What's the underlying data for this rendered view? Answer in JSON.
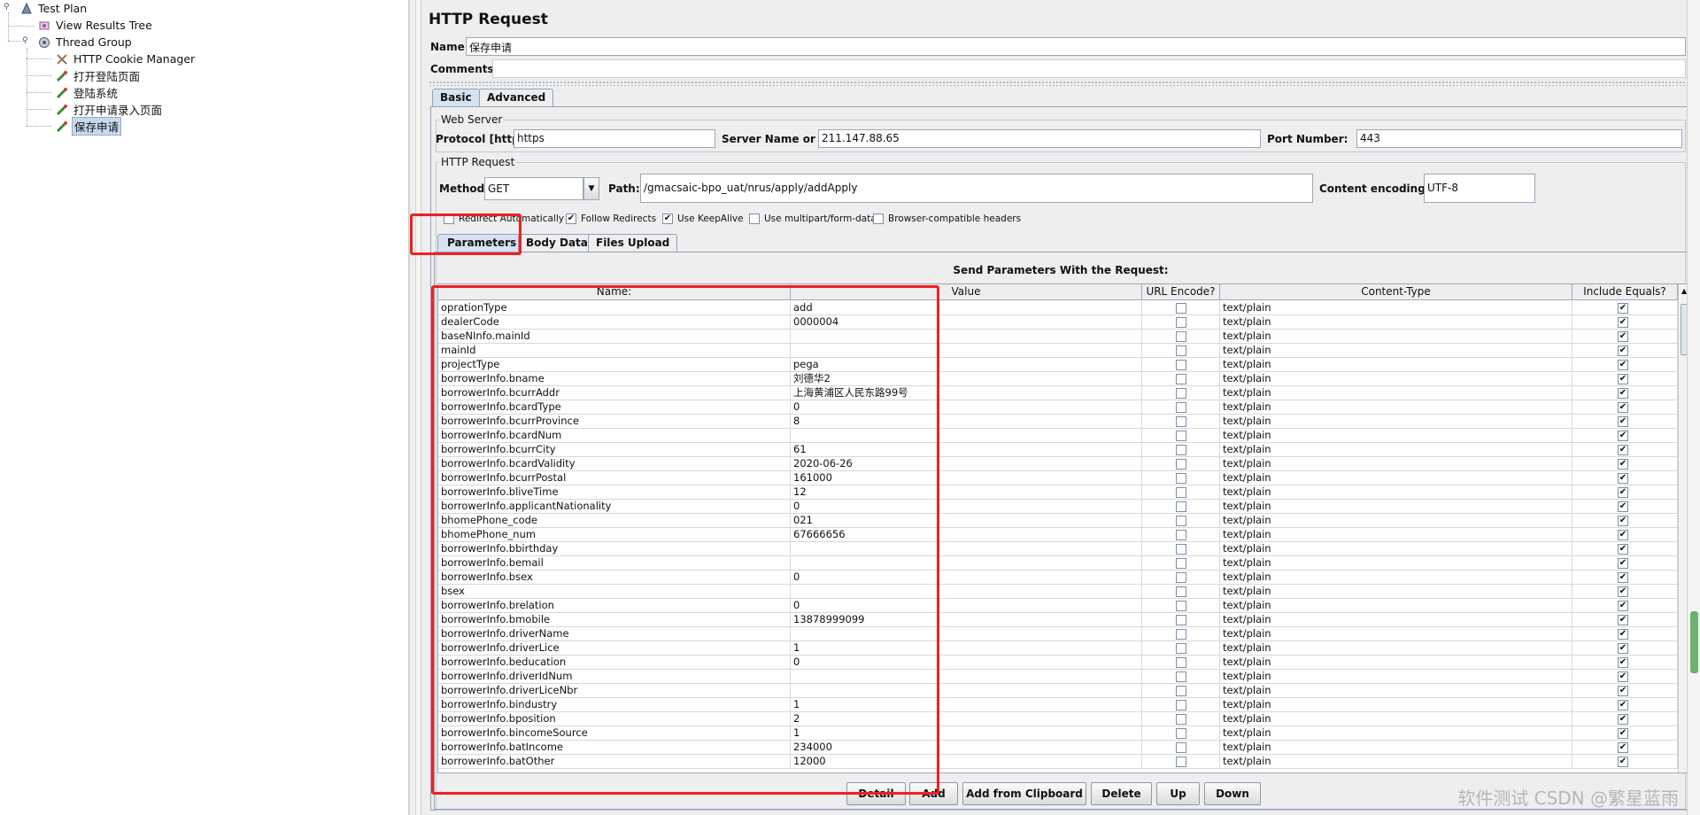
{
  "tree": {
    "items": [
      {
        "label": "Test Plan",
        "icon": "test-plan-icon"
      },
      {
        "label": "View Results Tree",
        "icon": "results-tree-icon"
      },
      {
        "label": "Thread Group",
        "icon": "thread-group-icon"
      },
      {
        "label": "HTTP Cookie Manager",
        "icon": "cookie-manager-icon"
      },
      {
        "label": "打开登陆页面",
        "icon": "sampler-icon"
      },
      {
        "label": "登陆系统",
        "icon": "sampler-icon"
      },
      {
        "label": "打开申请录入页面",
        "icon": "sampler-icon"
      },
      {
        "label": "保存申请",
        "icon": "sampler-icon",
        "selected": true
      }
    ]
  },
  "panel": {
    "title": "HTTP Request",
    "name_label": "Name:",
    "name_value": "保存申请",
    "comments_label": "Comments:",
    "tabs": [
      "Basic",
      "Advanced"
    ],
    "active_tab": "Basic",
    "web_server": {
      "legend": "Web Server",
      "protocol_label": "Protocol [http]:",
      "protocol_value": "https",
      "server_label": "Server Name or IP:",
      "server_value": "211.147.88.65",
      "port_label": "Port Number:",
      "port_value": "443"
    },
    "http_request": {
      "legend": "HTTP Request",
      "method_label": "Method:",
      "method_value": "GET",
      "path_label": "Path:",
      "path_value": "/gmacsaic-bpo_uat/nrus/apply/addApply",
      "encoding_label": "Content encoding:",
      "encoding_value": "UTF-8"
    },
    "options": [
      {
        "label": "Redirect Automatically",
        "checked": false
      },
      {
        "label": "Follow Redirects",
        "checked": true
      },
      {
        "label": "Use KeepAlive",
        "checked": true
      },
      {
        "label": "Use multipart/form-data",
        "checked": false
      },
      {
        "label": "Browser-compatible headers",
        "checked": false
      }
    ],
    "subtabs": [
      "Parameters",
      "Body Data",
      "Files Upload"
    ],
    "active_subtab": "Parameters",
    "table_title": "Send Parameters With the Request:",
    "columns": [
      "Name:",
      "Value",
      "URL Encode?",
      "Content-Type",
      "Include Equals?"
    ],
    "rows": [
      {
        "name": "oprationType",
        "value": "add"
      },
      {
        "name": "dealerCode",
        "value": "0000004"
      },
      {
        "name": "baseNInfo.mainId",
        "value": ""
      },
      {
        "name": "mainId",
        "value": ""
      },
      {
        "name": "projectType",
        "value": "pega"
      },
      {
        "name": "borrowerInfo.bname",
        "value": "刘德华2"
      },
      {
        "name": "borrowerInfo.bcurrAddr",
        "value": "上海黄浦区人民东路99号"
      },
      {
        "name": "borrowerInfo.bcardType",
        "value": "0"
      },
      {
        "name": "borrowerInfo.bcurrProvince",
        "value": "8"
      },
      {
        "name": "borrowerInfo.bcardNum",
        "value": ""
      },
      {
        "name": "borrowerInfo.bcurrCity",
        "value": "61"
      },
      {
        "name": "borrowerInfo.bcardValidity",
        "value": "2020-06-26"
      },
      {
        "name": "borrowerInfo.bcurrPostal",
        "value": "161000"
      },
      {
        "name": "borrowerInfo.bliveTime",
        "value": "12"
      },
      {
        "name": "borrowerInfo.applicantNationality",
        "value": "0"
      },
      {
        "name": "bhomePhone_code",
        "value": "021"
      },
      {
        "name": "bhomePhone_num",
        "value": "67666656"
      },
      {
        "name": "borrowerInfo.bbirthday",
        "value": ""
      },
      {
        "name": "borrowerInfo.bemail",
        "value": ""
      },
      {
        "name": "borrowerInfo.bsex",
        "value": "0"
      },
      {
        "name": "bsex",
        "value": ""
      },
      {
        "name": "borrowerInfo.brelation",
        "value": "0"
      },
      {
        "name": "borrowerInfo.bmobile",
        "value": "13878999099"
      },
      {
        "name": "borrowerInfo.driverName",
        "value": ""
      },
      {
        "name": "borrowerInfo.driverLice",
        "value": "1"
      },
      {
        "name": "borrowerInfo.beducation",
        "value": "0"
      },
      {
        "name": "borrowerInfo.driverIdNum",
        "value": ""
      },
      {
        "name": "borrowerInfo.driverLiceNbr",
        "value": ""
      },
      {
        "name": "borrowerInfo.bindustry",
        "value": "1"
      },
      {
        "name": "borrowerInfo.bposition",
        "value": "2"
      },
      {
        "name": "borrowerInfo.bincomeSource",
        "value": "1"
      },
      {
        "name": "borrowerInfo.batIncome",
        "value": "234000"
      },
      {
        "name": "borrowerInfo.batOther",
        "value": "12000"
      }
    ],
    "row_content_type": "text/plain",
    "buttons": [
      "Detail",
      "Add",
      "Add from Clipboard",
      "Delete",
      "Up",
      "Down"
    ]
  },
  "watermark": "软件测试 CSDN @繁星蓝雨",
  "colors": {
    "highlight_red": "#f02020",
    "selected_bg": "#c8d8ee"
  }
}
